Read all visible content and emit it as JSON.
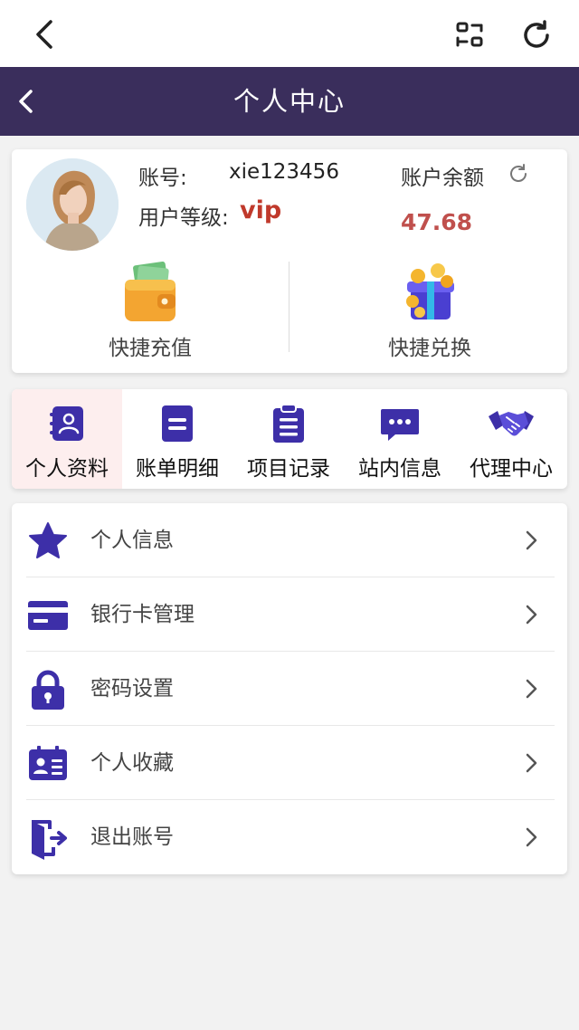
{
  "colors": {
    "header_bg": "#3a2e5c",
    "accent": "#3d2fa8",
    "vip": "#c0392b",
    "balance": "#c0504d"
  },
  "topbar": {
    "icons": [
      "back-icon",
      "scan-icon",
      "refresh-icon"
    ]
  },
  "header": {
    "title": "个人中心"
  },
  "profile": {
    "account_label": "账号:",
    "account_value": "xie123456",
    "level_label": "用户等级:",
    "level_value": "vip",
    "balance_label": "账户余额",
    "balance_value": "47.68"
  },
  "quick_actions": [
    {
      "label": "快捷充值",
      "icon": "wallet-icon"
    },
    {
      "label": "快捷兑换",
      "icon": "gift-box-icon"
    }
  ],
  "tabs": [
    {
      "label": "个人资料",
      "icon": "profile-book-icon",
      "active": true
    },
    {
      "label": "账单明细",
      "icon": "bill-icon"
    },
    {
      "label": "项目记录",
      "icon": "clipboard-icon"
    },
    {
      "label": "站内信息",
      "icon": "message-icon"
    },
    {
      "label": "代理中心",
      "icon": "handshake-icon"
    }
  ],
  "menu": [
    {
      "label": "个人信息",
      "icon": "star-icon"
    },
    {
      "label": "银行卡管理",
      "icon": "bank-card-icon"
    },
    {
      "label": "密码设置",
      "icon": "lock-icon"
    },
    {
      "label": "个人收藏",
      "icon": "id-card-icon"
    },
    {
      "label": "退出账号",
      "icon": "logout-icon"
    }
  ]
}
